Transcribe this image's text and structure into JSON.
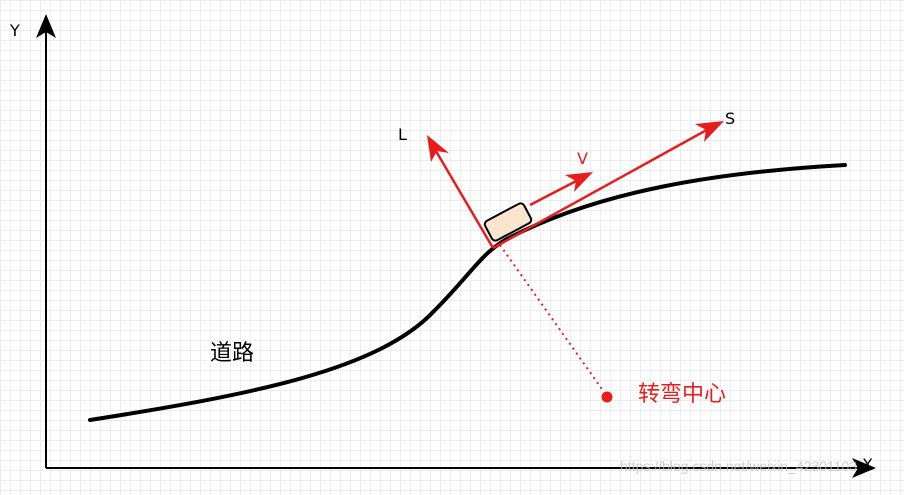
{
  "axes": {
    "x_label": "X",
    "y_label": "Y"
  },
  "road": {
    "label": "道路"
  },
  "vehicle": {
    "l_label": "L",
    "s_label": "S",
    "v_label": "V"
  },
  "turn_center": {
    "label": "转弯中心"
  },
  "watermark": "https://blog.csdn.net/weixin_42301103",
  "colors": {
    "axis": "#000000",
    "road": "#000000",
    "vector": "#e81c1c",
    "turn_center": "#e81c1c",
    "car_fill": "#fbe5cf",
    "car_stroke": "#000000",
    "grid": "#ececec"
  }
}
